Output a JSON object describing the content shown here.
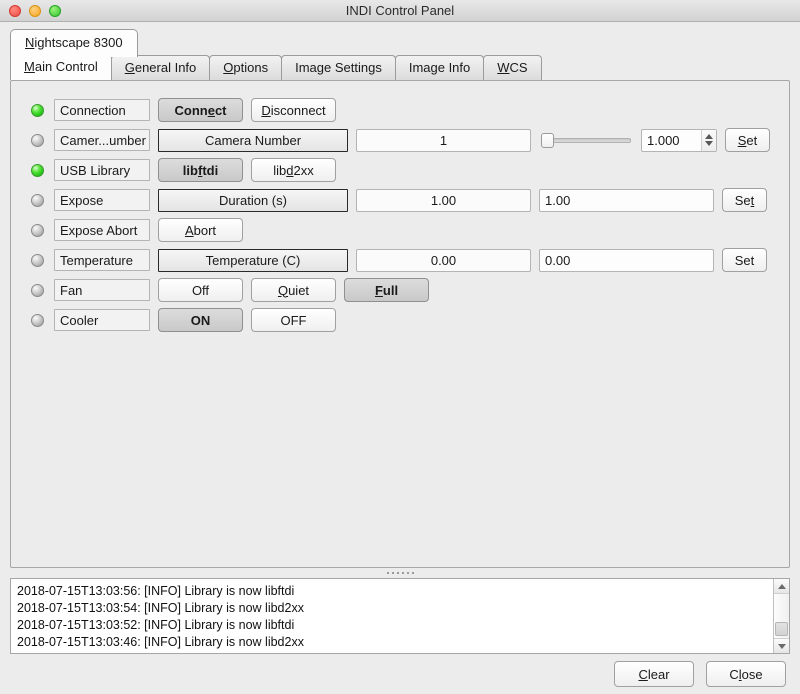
{
  "window": {
    "title": "INDI Control Panel",
    "traffic_lights": [
      "close-red",
      "minimize-yellow",
      "zoom-green"
    ]
  },
  "device_tabs": [
    {
      "label": "Nightscape 8300",
      "mnemonic": "N",
      "active": true
    }
  ],
  "inner_tabs": [
    {
      "label": "Main Control",
      "mnemonic": "M",
      "active": true
    },
    {
      "label": "General Info",
      "mnemonic": "G",
      "active": false
    },
    {
      "label": "Options",
      "mnemonic": "O",
      "active": false
    },
    {
      "label": "Image Settings",
      "mnemonic": "",
      "active": false
    },
    {
      "label": "Image Info",
      "mnemonic": "",
      "active": false
    },
    {
      "label": "WCS",
      "mnemonic": "W",
      "active": false
    }
  ],
  "properties": [
    {
      "led": "on",
      "label": "Connection",
      "buttons": [
        {
          "label": "Connect",
          "mnemonic": "e",
          "pressed": true
        },
        {
          "label": "Disconnect",
          "mnemonic": "D",
          "pressed": false
        }
      ]
    },
    {
      "led": "off",
      "label": "Camer...umber",
      "full_label": "Camera Number",
      "wide_button": "Camera Number",
      "value_readonly": "1",
      "slider": {
        "value": 0,
        "min": 0,
        "max": 100
      },
      "spin_value": "1.000",
      "set_label": "Set",
      "set_mnemonic": "S"
    },
    {
      "led": "on",
      "label": "USB Library",
      "buttons": [
        {
          "label": "libftdi",
          "mnemonic": "f",
          "pressed": true
        },
        {
          "label": "libd2xx",
          "mnemonic": "d",
          "pressed": false
        }
      ]
    },
    {
      "led": "off",
      "label": "Expose",
      "wide_button": "Duration (s)",
      "value_readonly": "1.00",
      "value_editable": "1.00",
      "set_label": "Set",
      "set_mnemonic": "t"
    },
    {
      "led": "off",
      "label": "Expose Abort",
      "buttons": [
        {
          "label": "Abort",
          "mnemonic": "A",
          "pressed": false
        }
      ]
    },
    {
      "led": "off",
      "label": "Temperature",
      "wide_button": "Temperature (C)",
      "value_readonly": "0.00",
      "value_editable": "0.00",
      "set_label": "Set",
      "set_mnemonic": ""
    },
    {
      "led": "off",
      "label": "Fan",
      "buttons": [
        {
          "label": "Off",
          "mnemonic": "",
          "pressed": false
        },
        {
          "label": "Quiet",
          "mnemonic": "Q",
          "pressed": false
        },
        {
          "label": "Full",
          "mnemonic": "F",
          "pressed": true
        }
      ]
    },
    {
      "led": "off",
      "label": "Cooler",
      "buttons": [
        {
          "label": "ON",
          "mnemonic": "",
          "pressed": true
        },
        {
          "label": "OFF",
          "mnemonic": "",
          "pressed": false
        }
      ]
    }
  ],
  "log": {
    "lines": [
      "2018-07-15T13:03:56: [INFO] Library is now libftdi",
      "2018-07-15T13:03:54: [INFO] Library is now libd2xx",
      "2018-07-15T13:03:52: [INFO] Library is now libftdi",
      "2018-07-15T13:03:46: [INFO] Library is now libd2xx"
    ],
    "scroll_position": "bottom"
  },
  "footer": {
    "clear_label": "Clear",
    "clear_mnemonic": "C",
    "close_label": "Close",
    "close_mnemonic": "l"
  },
  "colors": {
    "led_on": "#2fc62f",
    "led_off": "#b8b8b8",
    "window_bg": "#ececec",
    "panel_border": "#a6a6a6"
  }
}
